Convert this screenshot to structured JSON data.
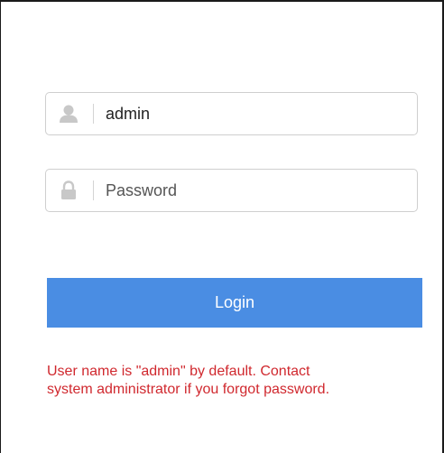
{
  "login_form": {
    "username": {
      "icon": "user-icon",
      "value": "admin"
    },
    "password": {
      "icon": "lock-icon",
      "value": "",
      "placeholder": "Password"
    },
    "login_label": "Login",
    "hint_line1": "User name is \"admin\" by default. Contact",
    "hint_line2": "system administrator if you forgot password."
  },
  "colors": {
    "button": "#4a8de3",
    "hint_text": "#d0282e",
    "field_border": "#cfcfcf",
    "icon": "#c8c8c8"
  }
}
